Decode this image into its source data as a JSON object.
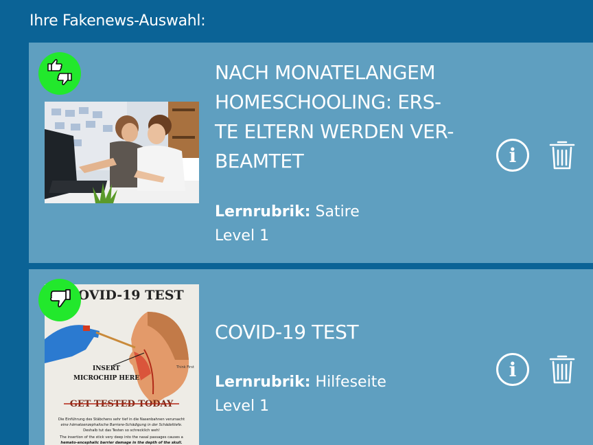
{
  "header": {
    "title": "Ihre Fakenews-Auswahl:"
  },
  "items": [
    {
      "title": "Nach monatelangem Homeschooling: Ers-te Eltern werden ver-beamtet",
      "title_lines": [
        "NACH MONATELANGEM",
        "HOMESCHOOLING: ERS-",
        "TE ELTERN WERDEN VER-",
        "BEAMTET"
      ],
      "rubric_label": "Lernrubrik:",
      "rubric_value": "Satire",
      "level": "Level 1",
      "badge_icon": "thumbs-up-down-icon",
      "image": "homeschooling-photo"
    },
    {
      "title": "COVID-19 TEST",
      "title_lines": [
        "COVID-19 TEST"
      ],
      "rubric_label": "Lernrubrik:",
      "rubric_value": "Hilfeseite",
      "level": "Level 1",
      "badge_icon": "thumbs-down-icon",
      "image": "covid-test-poster",
      "poster": {
        "headline": "COVID-19 TEST",
        "label_line1": "INSERT",
        "label_line2": "MICROCHIP HERE",
        "stamp": "GET TESTED TODAY",
        "side_text": "Think First",
        "caption_de_1": "Die Einführung des Stäbchens sehr tief in die Nasenbahnen verursacht",
        "caption_de_2": "eine hämatoenzephalische Barriere-Schädigung in der Schädeltiefe.",
        "caption_de_3": "Deshalb tut das Testen so schrecklich weh!",
        "caption_en_1": "The insertion of the stick very deep into the nasal passages causes a",
        "caption_en_2": "hemato-encephalic barrier damage in the depth of the skull."
      }
    }
  ],
  "colors": {
    "background": "#0b6396",
    "card": "#5f9fc0",
    "badge": "#22e82c"
  }
}
